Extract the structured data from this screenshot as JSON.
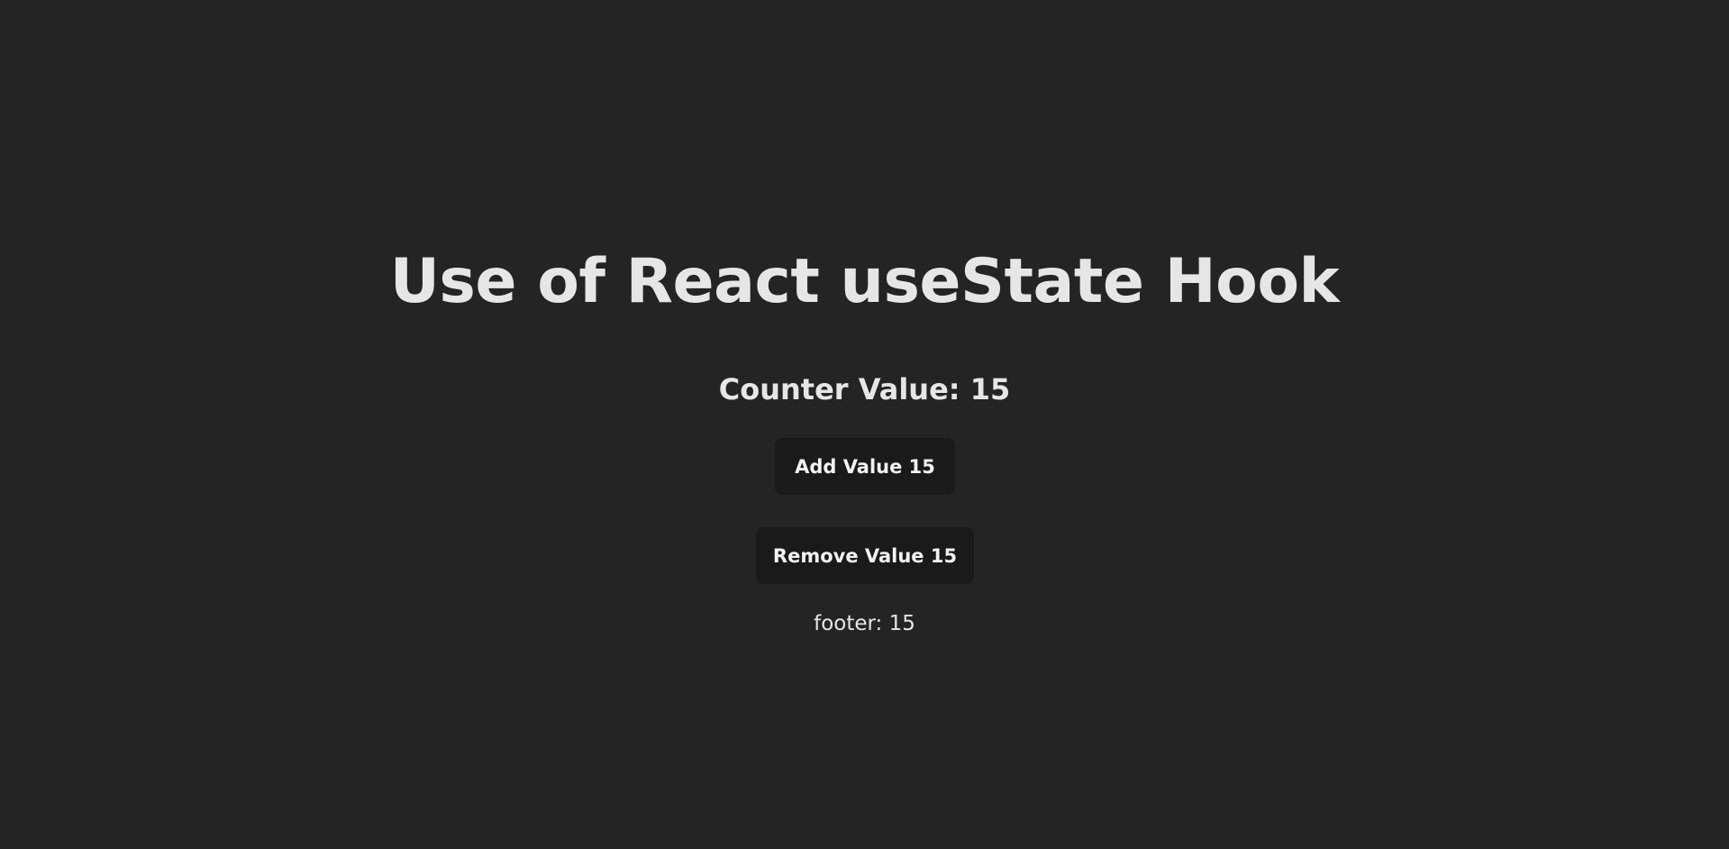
{
  "page": {
    "background_color": "#242424",
    "text_color": "#e6e6e6"
  },
  "main": {
    "title": "Use of React useState Hook",
    "counter_text": "Counter Value: 15",
    "add_button_label": "Add Value 15",
    "remove_button_label": "Remove Value 15",
    "footer_text": "footer: 15",
    "button_background": "#1a1a1a"
  }
}
